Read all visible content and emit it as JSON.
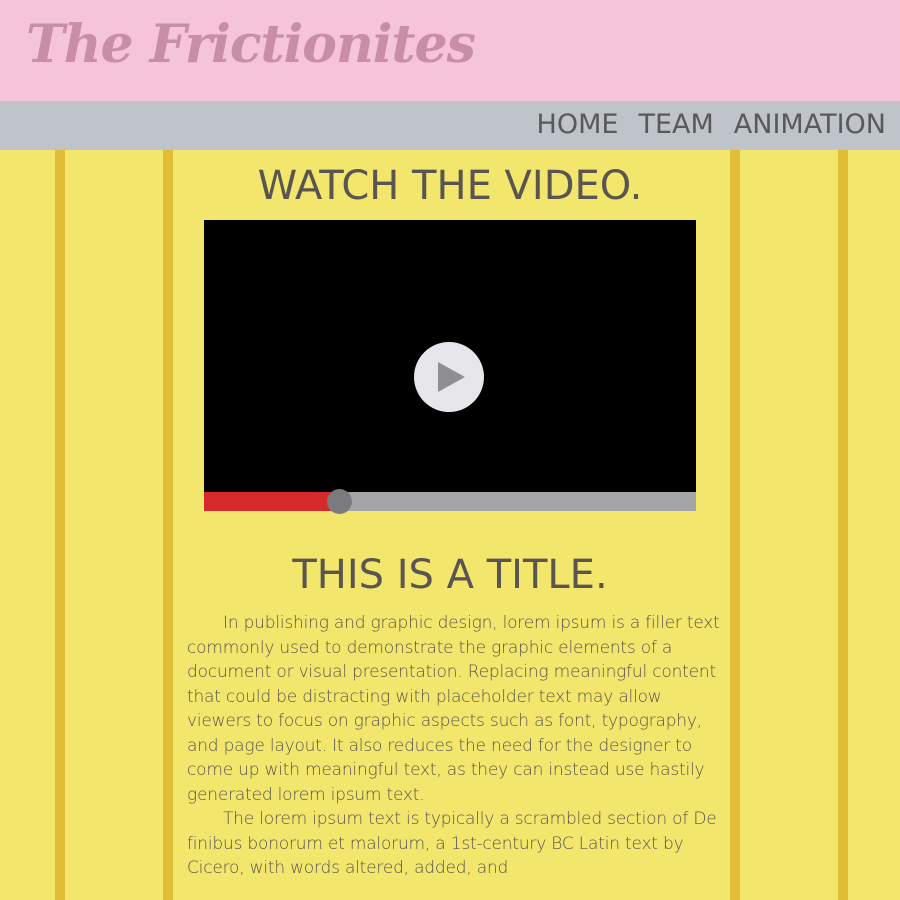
{
  "header": {
    "logo_text": "The Frictionites"
  },
  "nav": {
    "items": [
      {
        "label": "HOME"
      },
      {
        "label": "TEAM"
      },
      {
        "label": "ANIMATION"
      }
    ]
  },
  "video_section": {
    "heading": "WATCH THE VIDEO.",
    "player": {
      "play_icon": "play-icon",
      "progress_percent": 27.5,
      "progress_color": "#d62a2a",
      "track_color": "#a5a5a7"
    }
  },
  "article": {
    "title": "THIS IS A TITLE.",
    "paragraphs": [
      "In publishing and graphic design, lorem ipsum is a filler text commonly used to demonstrate the graphic elements of a document or visual presentation. Replacing meaningful content that could be distracting with placeholder text may allow viewers to focus on graphic aspects such as font, typography, and page layout. It also reduces the need for the designer to come up with meaningful text, as they can instead use hastily generated lorem ipsum text.",
      "The lorem ipsum text is typically a scrambled section of De finibus bonorum et malorum, a 1st-century BC Latin text by Cicero, with words altered, added, and"
    ]
  },
  "colors": {
    "background": "#f2e66c",
    "stripes": "#e2bd36",
    "header": "#f5c3da",
    "logo": "#c88ea7",
    "navbar": "#bfc3ca",
    "text": "#5a5551"
  }
}
